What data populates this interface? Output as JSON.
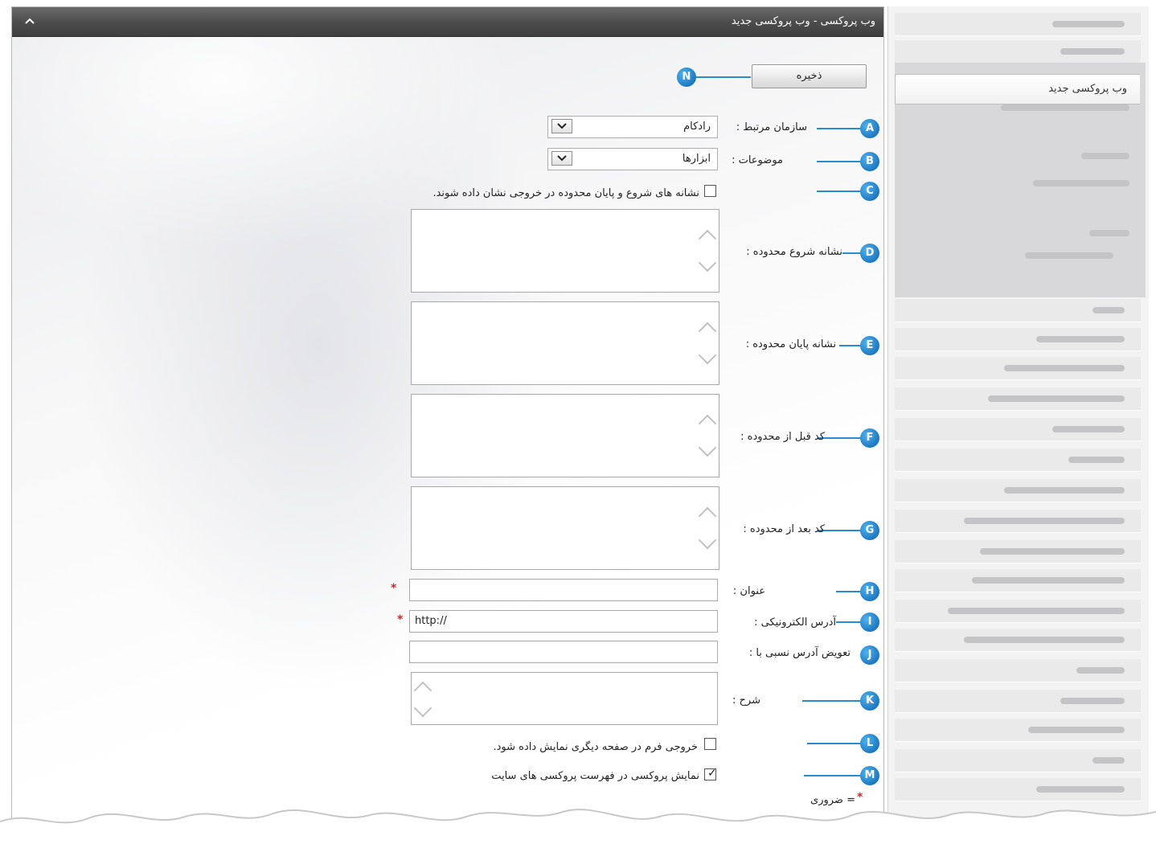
{
  "panel": {
    "title": "وب پروکسی - وب پروکسی جدید"
  },
  "sidebar": {
    "active_item": "وب پروکسی جدید"
  },
  "toolbar": {
    "save_label": "ذخیره"
  },
  "form": {
    "organization": {
      "label": "سازمان مرتبط :",
      "value": "رادکام"
    },
    "topics": {
      "label": "موضوعات :",
      "value": "ابزارها"
    },
    "show_markers": {
      "label": "نشانه های شروع و پایان محدوده در خروجی نشان داده شوند.",
      "checked": false
    },
    "range_start": {
      "label": "نشانه شروع محدوده :"
    },
    "range_end": {
      "label": "نشانه پایان محدوده :"
    },
    "code_before": {
      "label": "کد قبل از محدوده :"
    },
    "code_after": {
      "label": "کد بعد از محدوده :"
    },
    "title": {
      "label": "عنوان :",
      "value": ""
    },
    "url": {
      "label": "آدرس الکترونیکی :",
      "value": "http://"
    },
    "relative_replace": {
      "label": "تعویض آدرس نسبی با :",
      "value": ""
    },
    "description": {
      "label": "شرح :"
    },
    "output_other_page": {
      "label": "خروجی فرم در صفحه دیگری نمایش داده شود.",
      "checked": false
    },
    "show_in_list": {
      "label": "نمایش پروکسی در فهرست پروکسی های سایت",
      "checked": true
    },
    "required_note": "= ضروری",
    "required_mark": "*"
  },
  "markers": {
    "a": "A",
    "b": "B",
    "c": "C",
    "d": "D",
    "e": "E",
    "f": "F",
    "g": "G",
    "h": "H",
    "i": "I",
    "j": "J",
    "k": "K",
    "l": "L",
    "m": "M",
    "n": "N"
  },
  "colors": {
    "accent": "#1f78c1",
    "header": "#4b4b4b",
    "required": "#e02020"
  }
}
